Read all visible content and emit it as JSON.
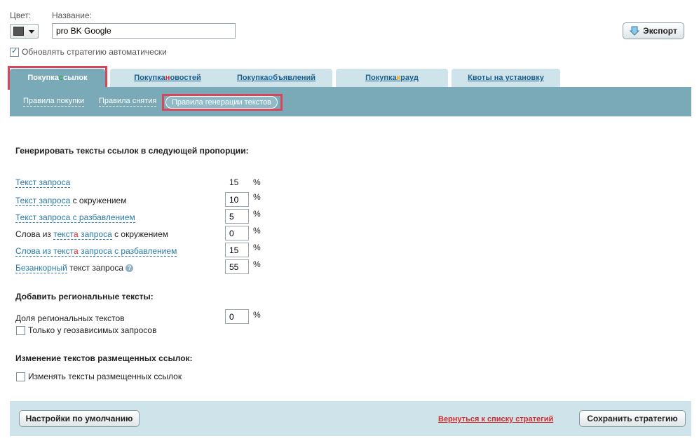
{
  "header": {
    "color_label": "Цвет:",
    "name_label": "Название:",
    "name_value": "pro BK Google",
    "export_label": "Экспорт",
    "auto_update_label": "Обновлять стратегию автоматически",
    "auto_update_checked": true,
    "color_value": "#555555"
  },
  "tabs": [
    {
      "pre": "Покупка ",
      "hl": "с",
      "post": "сылок",
      "hl_color": "#2ea84e",
      "active": true
    },
    {
      "pre": "Покупка ",
      "hl": "н",
      "post": "овостей",
      "hl_color": "#d72a2a",
      "active": false
    },
    {
      "pre": "Покупка ",
      "hl": "о",
      "post": "бъявлений",
      "hl_color": "#1e7fc9",
      "active": false
    },
    {
      "pre": "Покупка ",
      "hl": "к",
      "post": "рауд",
      "hl_color": "#f0a000",
      "active": false
    },
    {
      "pre": "",
      "hl": "",
      "post": "Квоты на установку",
      "hl_color": "",
      "active": false
    }
  ],
  "subnav": {
    "rules_buy": "Правила покупки",
    "rules_remove": "Правила снятия",
    "rules_texts": "Правила генерации текстов"
  },
  "proportion": {
    "heading": "Генерировать тексты ссылок в следующей пропорции:",
    "percent_sign": "%",
    "rows": {
      "r1": {
        "link": "Текст запроса",
        "value": "15"
      },
      "r2": {
        "link": "Текст запроса",
        "rest": " с окружением",
        "value": "10"
      },
      "r3": {
        "link": "Текст запроса с разбавлением",
        "value": "5"
      },
      "r4": {
        "pre": "Слова из ",
        "link_a": "текст",
        "link_hl": "а",
        "link_b": " запроса",
        "rest": " с окружением",
        "value": "0"
      },
      "r5": {
        "link_a": "Слова из текст",
        "link_hl": "а",
        "link_b": " запроса с разбавлением",
        "value": "15"
      },
      "r6": {
        "link": "Безанкорный",
        "rest": " текст запроса",
        "value": "55",
        "help_icon": "question-icon"
      }
    }
  },
  "regional": {
    "heading": "Добавить региональные тексты:",
    "share_label": "Доля региональных текстов",
    "share_value": "0",
    "geo_only_label": "Только у геозависимых запросов",
    "geo_only_checked": false
  },
  "placed": {
    "heading": "Изменение текстов размещенных ссылок:",
    "change_label": "Изменять тексты размещенных ссылок",
    "change_checked": false
  },
  "footer": {
    "defaults_label": "Настройки по умолчанию",
    "back_label": "Вернуться к списку стратегий",
    "save_label": "Сохранить стратегию"
  }
}
